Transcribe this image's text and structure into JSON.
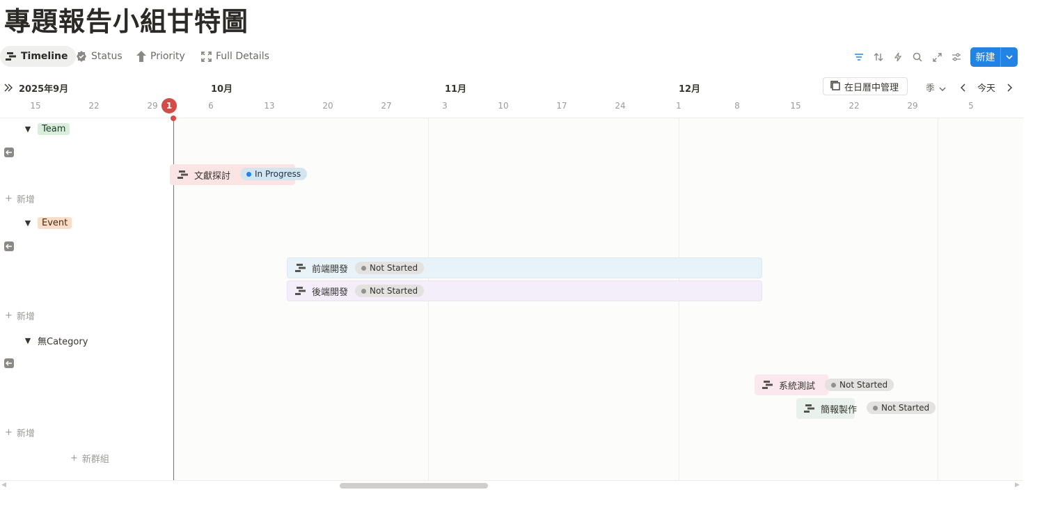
{
  "page": {
    "title": "專題報告小組甘特圖"
  },
  "tabs": [
    {
      "label": "Timeline",
      "icon": "timeline-icon"
    },
    {
      "label": "Status",
      "icon": "status-check-icon"
    },
    {
      "label": "Priority",
      "icon": "arrow-up-icon"
    },
    {
      "label": "Full Details",
      "icon": "expand-icon"
    }
  ],
  "toolbar": {
    "new_label": "新建",
    "calendar_label": "在日曆中管理",
    "period_label": "季",
    "today_label": "今天"
  },
  "timeline": {
    "start_month": "2025年9月",
    "months": [
      "10月",
      "11月",
      "12月"
    ],
    "days": [
      "15",
      "22",
      "29",
      "6",
      "13",
      "20",
      "27",
      "3",
      "10",
      "17",
      "24",
      "1",
      "8",
      "15",
      "22",
      "29",
      "5"
    ],
    "today_badge": "1"
  },
  "groups": [
    {
      "name": "Team",
      "add_label": "新增",
      "tag_bg": "#dbeddb",
      "tag_color": "#1c3829"
    },
    {
      "name": "Event",
      "add_label": "新增",
      "tag_bg": "#fadec9",
      "tag_color": "#49290e"
    },
    {
      "name": "無Category",
      "add_label": "新增"
    }
  ],
  "tasks": [
    {
      "name": "文獻探討",
      "status": "In Progress",
      "bar_color": "#fbe4e4",
      "pill_bg": "#d3e5ef",
      "pill_color": "#183347",
      "dot": "#2383e2"
    },
    {
      "name": "前端開發",
      "status": "Not Started",
      "bar_color": "#e7f3f8",
      "pill_bg": "#e3e2e0",
      "pill_color": "#32302c",
      "dot": "#91918e"
    },
    {
      "name": "後端開發",
      "status": "Not Started",
      "bar_color": "#f4eefa",
      "pill_bg": "#e3e2e0",
      "pill_color": "#32302c",
      "dot": "#91918e"
    },
    {
      "name": "系統測試",
      "status": "Not Started",
      "bar_color": "#fbe8ef",
      "pill_bg": "#e3e2e0",
      "pill_color": "#32302c",
      "dot": "#91918e"
    },
    {
      "name": "簡報製作",
      "status": "Not Started",
      "bar_color": "#e8f1ec",
      "pill_bg": "#e3e2e0",
      "pill_color": "#32302c",
      "dot": "#91918e"
    }
  ],
  "new_group_label": "新群組"
}
